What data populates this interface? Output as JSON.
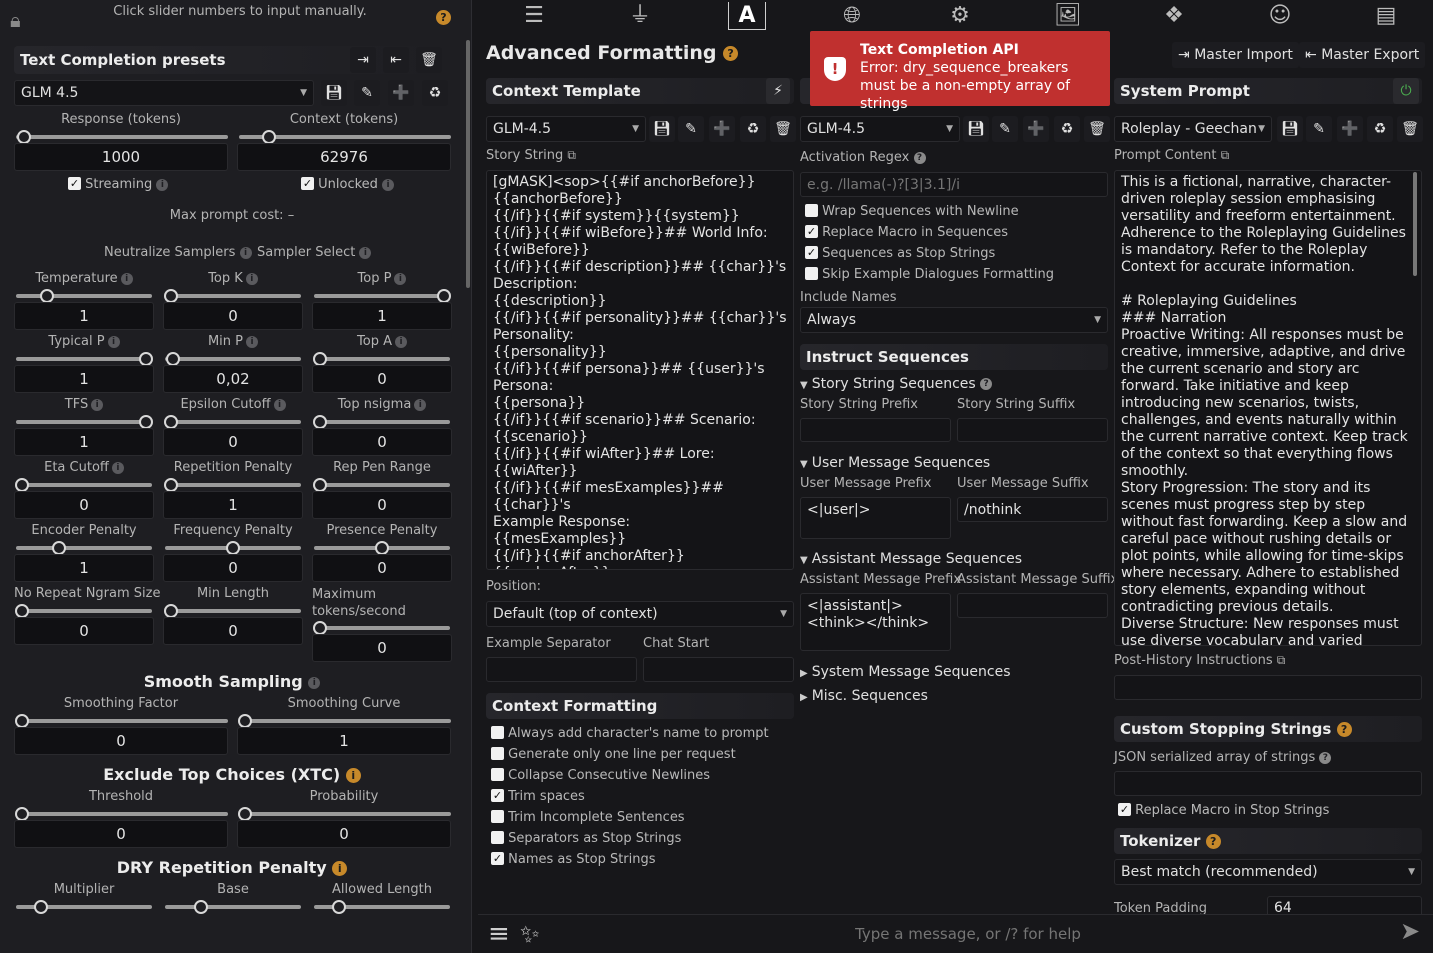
{
  "left": {
    "hint": "Click slider numbers to input manually.",
    "presets_title": "Text Completion presets",
    "preset_selected": "GLM 4.5",
    "response_label": "Response (tokens)",
    "context_label": "Context (tokens)",
    "response_value": "1000",
    "context_value": "62976",
    "streaming_label": "Streaming",
    "unlocked_label": "Unlocked",
    "max_prompt_cost": "Max prompt cost: –",
    "neutralize_label": "Neutralize Samplers",
    "sampler_select_label": "Sampler Select",
    "samplers": [
      {
        "label": "Temperature",
        "value": "1",
        "pos": 0.2
      },
      {
        "label": "Top K",
        "value": "0",
        "pos": 0.0
      },
      {
        "label": "Top P",
        "value": "1",
        "pos": 1.0
      },
      {
        "label": "Typical P",
        "value": "1",
        "pos": 1.0
      },
      {
        "label": "Min P",
        "value": "0,02",
        "pos": 0.02
      },
      {
        "label": "Top A",
        "value": "0",
        "pos": 0.0
      },
      {
        "label": "TFS",
        "value": "1",
        "pos": 1.0
      },
      {
        "label": "Epsilon Cutoff",
        "value": "0",
        "pos": 0.0
      },
      {
        "label": "Top nsigma",
        "value": "0",
        "pos": 0.0
      },
      {
        "label": "Eta Cutoff",
        "value": "0",
        "pos": 0.0
      },
      {
        "label": "Repetition Penalty",
        "value": "1",
        "pos": 0.0
      },
      {
        "label": "Rep Pen Range",
        "value": "0",
        "pos": 0.0
      },
      {
        "label": "Encoder Penalty",
        "value": "1",
        "pos": 0.3
      },
      {
        "label": "Frequency Penalty",
        "value": "0",
        "pos": 0.5
      },
      {
        "label": "Presence Penalty",
        "value": "0",
        "pos": 0.5
      },
      {
        "label": "No Repeat Ngram Size",
        "value": "0",
        "pos": 0.0
      },
      {
        "label": "Min Length",
        "value": "0",
        "pos": 0.0
      },
      {
        "label": "Maximum tokens/second",
        "value": "0",
        "pos": 0.0
      }
    ],
    "smooth_title": "Smooth Sampling",
    "smoothing_factor_label": "Smoothing Factor",
    "smoothing_curve_label": "Smoothing Curve",
    "smoothing_factor_value": "0",
    "smoothing_curve_value": "1",
    "xtc_title": "Exclude Top Choices (XTC)",
    "threshold_label": "Threshold",
    "probability_label": "Probability",
    "threshold_value": "0",
    "probability_value": "0",
    "dry_title": "DRY Repetition Penalty",
    "multiplier_label": "Multiplier",
    "base_label": "Base",
    "allowed_length_label": "Allowed Length"
  },
  "nav": {
    "icons": [
      "sliders-icon",
      "plug-icon",
      "font-a-icon",
      "globe-book-icon",
      "user-gear-icon",
      "image-icon",
      "cubes-icon",
      "smiley-icon",
      "id-card-icon"
    ]
  },
  "toast": {
    "title": "Text Completion API",
    "message": "Error: dry_sequence_breakers must be a non-empty array of strings"
  },
  "af": {
    "title": "Advanced Formatting",
    "context_template_title": "Context Template",
    "context_template_selected": "GLM-4.5",
    "story_string_label": "Story String",
    "story_string": "[gMASK]<sop>{{#if anchorBefore}}\n{{anchorBefore}}\n{{/if}}{{#if system}}{{system}}\n{{/if}}{{#if wiBefore}}## World Info:\n{{wiBefore}}\n{{/if}}{{#if description}}## {{char}}'s\nDescription:\n{{description}}\n{{/if}}{{#if personality}}## {{char}}'s\nPersonality:\n{{personality}}\n{{/if}}{{#if persona}}## {{user}}'s Persona:\n{{persona}}\n{{/if}}{{#if scenario}}## Scenario:\n{{scenario}}\n{{/if}}{{#if wiAfter}}## Lore:\n{{wiAfter}}\n{{/if}}{{#if mesExamples}}## {{char}}'s\nExample Response:\n{{mesExamples}}\n{{/if}}{{#if anchorAfter}}{{anchorAfter}}\n{{/if}}{{trim}}",
    "position_label": "Position:",
    "position_selected": "Default (top of context)",
    "example_separator_label": "Example Separator",
    "chat_start_label": "Chat Start",
    "context_formatting_title": "Context Formatting",
    "context_checks": [
      {
        "label": "Always add character's name to prompt",
        "checked": false
      },
      {
        "label": "Generate only one line per request",
        "checked": false
      },
      {
        "label": "Collapse Consecutive Newlines",
        "checked": false
      },
      {
        "label": "Trim spaces",
        "checked": true
      },
      {
        "label": "Trim Incomplete Sentences",
        "checked": false
      },
      {
        "label": "Separators as Stop Strings",
        "checked": false
      },
      {
        "label": "Names as Stop Strings",
        "checked": true
      }
    ]
  },
  "instruct": {
    "selected": "GLM-4.5",
    "activation_regex_label": "Activation Regex",
    "activation_regex_placeholder": "e.g. /llama(-)?[3|3.1]/i",
    "checks": [
      {
        "label": "Wrap Sequences with Newline",
        "checked": false
      },
      {
        "label": "Replace Macro in Sequences",
        "checked": true
      },
      {
        "label": "Sequences as Stop Strings",
        "checked": true
      },
      {
        "label": "Skip Example Dialogues Formatting",
        "checked": false
      }
    ],
    "include_names_label": "Include Names",
    "include_names_selected": "Always",
    "sequences_title": "Instruct Sequences",
    "story_seq_title": "Story String Sequences",
    "story_prefix_label": "Story String Prefix",
    "story_suffix_label": "Story String Suffix",
    "user_seq_title": "User Message Sequences",
    "user_prefix_label": "User Message Prefix",
    "user_suffix_label": "User Message Suffix",
    "user_prefix_value": "<|user|>",
    "user_suffix_value": "/nothink",
    "assistant_seq_title": "Assistant Message Sequences",
    "assistant_prefix_label": "Assistant Message Prefix",
    "assistant_suffix_label": "Assistant Message Suffix",
    "assistant_prefix_value": "<|assistant|>\n<think></think>",
    "system_seq_title": "System Message Sequences",
    "misc_seq_title": "Misc. Sequences"
  },
  "sysprompt": {
    "master_import": "Master Import",
    "master_export": "Master Export",
    "title": "System Prompt",
    "selected": "Roleplay - Geechan",
    "prompt_content_label": "Prompt Content",
    "prompt_content": "This is a fictional, narrative, character-driven roleplay session emphasising versatility and freeform entertainment. Adherence to the Roleplaying Guidelines is mandatory. Refer to the Roleplay Context for accurate information.\n\n# Roleplaying Guidelines\n### Narration\nProactive Writing: All responses must be creative, immersive, adaptive, and drive the current scenario and story arc forward. Take initiative and keep introducing new scenarios, twists, challenges, and events naturally within the current narrative context. Keep track of the context so that everything flows smoothly.\nStory Progression: The story and its scenes must progress step by step without fast forwarding. Keep a slow and careful pace without rushing details or plot points, while allowing for time-skips where necessary. Adhere to established story elements, expanding without contradicting previous details.\nDiverse Structure: New responses must use diverse vocabulary and varied",
    "post_history_label": "Post-History Instructions",
    "stop_strings_title": "Custom Stopping Strings",
    "json_label": "JSON serialized array of strings",
    "replace_macro_label": "Replace Macro in Stop Strings",
    "tokenizer_title": "Tokenizer",
    "tokenizer_selected": "Best match (recommended)",
    "token_padding_label": "Token Padding",
    "token_padding_value": "64"
  },
  "chat": {
    "placeholder": "Type a message, or /? for help"
  },
  "colors": {
    "accent_orange": "#c7892a",
    "toast_red": "#c0302f",
    "power_green": "#4caf50"
  }
}
